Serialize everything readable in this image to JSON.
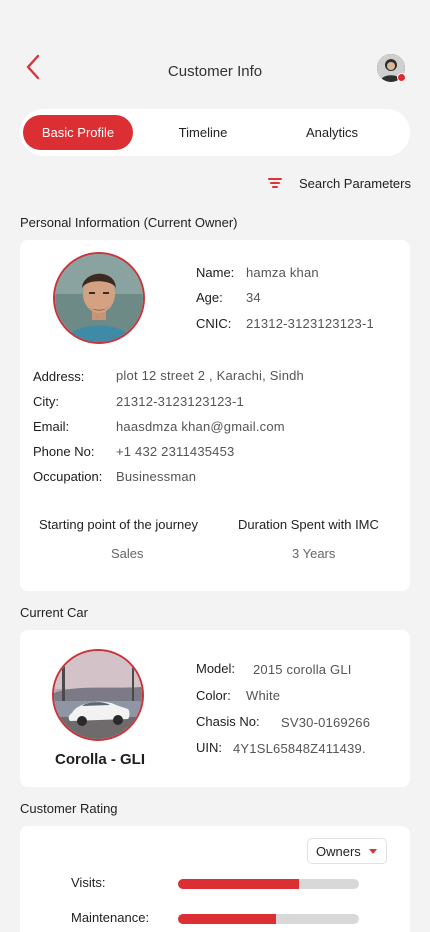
{
  "header": {
    "title": "Customer Info"
  },
  "tabs": [
    {
      "label": "Basic Profile",
      "active": true
    },
    {
      "label": "Timeline",
      "active": false
    },
    {
      "label": "Analytics",
      "active": false
    }
  ],
  "search": {
    "label": "Search Parameters"
  },
  "personal": {
    "section_title": "Personal Information (Current Owner)",
    "name_label": "Name:",
    "name": "hamza khan",
    "age_label": "Age:",
    "age": "34",
    "cnic_label": "CNIC:",
    "cnic": "21312-3123123123-1",
    "address_label": "Address:",
    "address": "plot 12 street 2 , Karachi, Sindh",
    "city_label": "City:",
    "city": "21312-3123123123-1",
    "email_label": "Email:",
    "email": "haasdmza khan@gmail.com",
    "phone_label": "Phone No:",
    "phone": "+1 432 2311435453",
    "occupation_label": "Occupation:",
    "occupation": "Businessman",
    "journey_label": "Starting point of the journey",
    "journey": "Sales",
    "duration_label": "Duration Spent with IMC",
    "duration": "3 Years"
  },
  "car": {
    "section_title": "Current Car",
    "name": "Corolla - GLI",
    "model_label": "Model:",
    "model": "2015 corolla GLI",
    "color_label": "Color:",
    "color": "White",
    "chassis_label": "Chasis No:",
    "chassis": "SV30-0169266",
    "uin_label": "UIN:",
    "uin": "4Y1SL65848Z411439."
  },
  "rating": {
    "section_title": "Customer Rating",
    "filter": "Owners",
    "items": [
      {
        "label": "Visits:",
        "value": 0.67
      },
      {
        "label": "Maintenance:",
        "value": 0.54
      }
    ]
  },
  "colors": {
    "accent": "#dc2f33",
    "track": "#d8d8d8",
    "background": "#f3f3f3"
  }
}
